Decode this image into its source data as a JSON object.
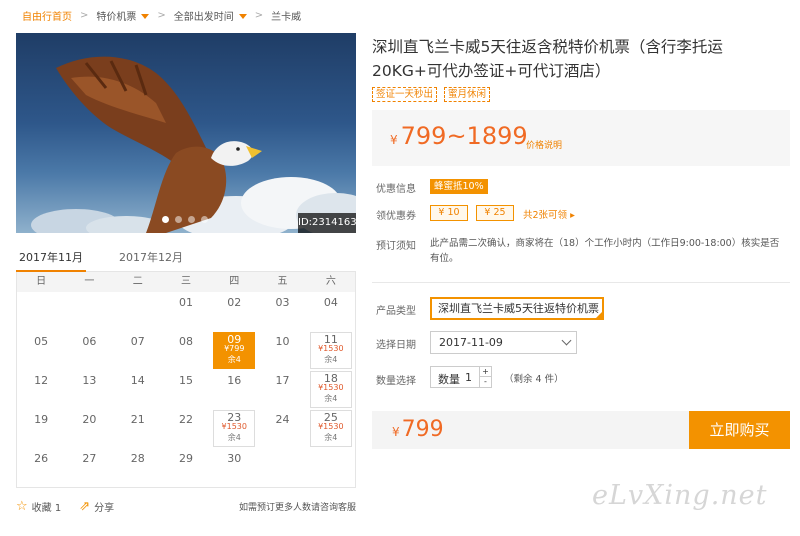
{
  "breadcrumb": {
    "home": "自由行首页",
    "level2": "特价机票",
    "level3": "全部出发时间",
    "current": "兰卡威",
    "separator": ">"
  },
  "hero": {
    "id_label": "ID:2314163",
    "slide_count": 4,
    "active_slide": 1
  },
  "calendar": {
    "tabs": [
      "2017年11月",
      "2017年12月"
    ],
    "active_tab": 0,
    "weekdays": [
      "日",
      "一",
      "二",
      "三",
      "四",
      "五",
      "六"
    ],
    "weeks": [
      [
        {
          "d": ""
        },
        {
          "d": ""
        },
        {
          "d": ""
        },
        {
          "d": "01"
        },
        {
          "d": "02"
        },
        {
          "d": "03"
        },
        {
          "d": "04"
        }
      ],
      [
        {
          "d": "05"
        },
        {
          "d": "06"
        },
        {
          "d": "07"
        },
        {
          "d": "08"
        },
        {
          "d": "09",
          "price": "¥799",
          "remain": "余4",
          "selected": true
        },
        {
          "d": "10"
        },
        {
          "d": "11",
          "price": "¥1530",
          "remain": "余4"
        }
      ],
      [
        {
          "d": "12"
        },
        {
          "d": "13"
        },
        {
          "d": "14"
        },
        {
          "d": "15"
        },
        {
          "d": "16"
        },
        {
          "d": "17"
        },
        {
          "d": "18",
          "price": "¥1530",
          "remain": "余4"
        }
      ],
      [
        {
          "d": "19"
        },
        {
          "d": "20"
        },
        {
          "d": "21"
        },
        {
          "d": "22"
        },
        {
          "d": "23",
          "price": "¥1530",
          "remain": "余4"
        },
        {
          "d": "24"
        },
        {
          "d": "25",
          "price": "¥1530",
          "remain": "余4"
        }
      ],
      [
        {
          "d": "26"
        },
        {
          "d": "27"
        },
        {
          "d": "28"
        },
        {
          "d": "29"
        },
        {
          "d": "30"
        },
        {
          "d": ""
        },
        {
          "d": ""
        }
      ]
    ]
  },
  "actions": {
    "favorite": "收藏 1",
    "share": "分享",
    "note": "如需预订更多人数请咨询客服"
  },
  "product": {
    "title": "深圳直飞兰卡威5天往返含税特价机票（含行李托运20KG+可代办签证+可代订酒店）",
    "tags": [
      "签证一天秒出",
      "蜜月休闲"
    ],
    "currency": "¥",
    "price_range": "799~1899",
    "price_note": "价格说明"
  },
  "info": {
    "discount_label": "优惠信息",
    "discount_badge": "蜂蜜抵10%",
    "coupon_label": "领优惠券",
    "coupons": [
      "¥ 10",
      "¥ 25"
    ],
    "coupon_more": "共2张可领 ▸",
    "notice_label": "预订须知",
    "notice_text": "此产品需二次确认，商家将在（18）个工作小时内（工作日9:00-18:00）核实是否有位。"
  },
  "order": {
    "type_label": "产品类型",
    "type_value": "深圳直飞兰卡威5天往返特价机票",
    "date_label": "选择日期",
    "date_value": "2017-11-09",
    "qty_label": "数量选择",
    "qty_field_label": "数量",
    "qty_value": "1",
    "qty_plus": "+",
    "qty_minus": "-",
    "stock": "（剩余 4 件）"
  },
  "buy": {
    "price": "799",
    "button": "立即购买"
  },
  "watermark": "eLvXing.net",
  "colors": {
    "accent": "#f39200",
    "price": "#f06a24"
  }
}
